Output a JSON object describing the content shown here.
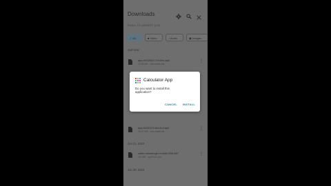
{
  "header": {
    "title": "Downloads",
    "subtitle": "SMALL TO LARGEST (1-5)",
    "icons": [
      "gear-icon",
      "search-icon",
      "close-icon"
    ]
  },
  "filters": [
    {
      "label": "All",
      "active": true
    },
    {
      "label": "Video",
      "active": false
    },
    {
      "label": "Audio",
      "active": false
    },
    {
      "label": "Images",
      "active": false
    }
  ],
  "sections": {
    "just_now": "Just now",
    "jun21": "Jun 21, 2023",
    "jun20": "Jun 20, 2023"
  },
  "files": [
    {
      "name": "app-0402643-17e2e4.apk",
      "meta": "10.95 MB · xda-install.net"
    },
    {
      "name": "app-0402124-8ec4c4.apk",
      "meta": "15.47 MB · xda-install.net"
    },
    {
      "name": "caller.messenger.mobile-558-487",
      "meta": "112 MB · apkPure.com"
    }
  ],
  "dialog": {
    "title": "Calculator App",
    "message": "Do you want to install this application?",
    "cancel": "CANCEL",
    "install": "INSTALL",
    "icon_colors": [
      "#e05050",
      "#e0a040",
      "#50a0e0",
      "#50c070",
      "#a060d0",
      "#e05090",
      "#4080c0",
      "#c0c040",
      "#60c0c0"
    ]
  },
  "colors": {
    "accent": "#2f7f8f",
    "dim_background": "#6e6e6e"
  }
}
